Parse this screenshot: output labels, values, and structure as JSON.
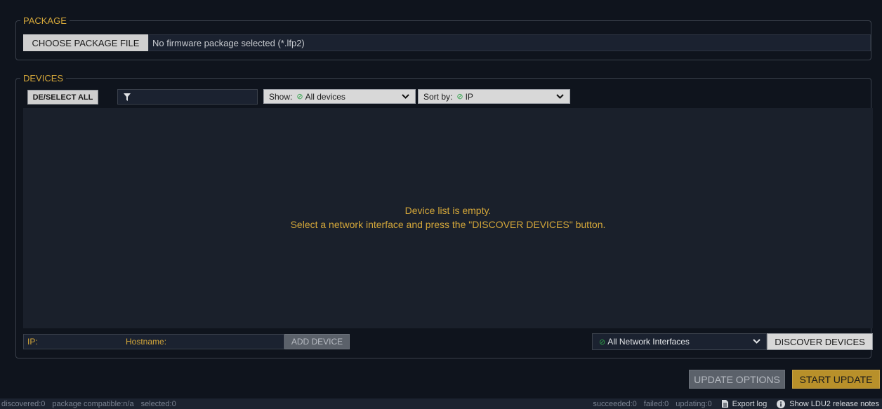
{
  "package": {
    "legend": "PACKAGE",
    "choose_label": "CHOOSE PACKAGE FILE",
    "file_text": "No firmware package selected (*.lfp2)"
  },
  "devices": {
    "legend": "DEVICES",
    "deselect_label": "DE/SELECT ALL",
    "filter_icon": "filter-icon",
    "show": {
      "label": "Show:",
      "value": "All devices"
    },
    "sort": {
      "label": "Sort by:",
      "value": "IP"
    },
    "empty_line1": "Device list is empty.",
    "empty_line2": "Select a network interface and press the \"DISCOVER DEVICES\" button.",
    "ip_label": "IP:",
    "hostname_label": "Hostname:",
    "add_device_label": "ADD DEVICE",
    "network_select": "All Network Interfaces",
    "discover_label": "DISCOVER DEVICES"
  },
  "actions": {
    "update_options_label": "UPDATE OPTIONS",
    "start_update_label": "START UPDATE"
  },
  "status": {
    "discovered": "discovered:0",
    "compatible": "package compatible:n/a",
    "selected": "selected:0",
    "succeeded": "succeeded:0",
    "failed": "failed:0",
    "updating": "updating:0",
    "export_log": "Export log",
    "release_notes": "Show LDU2 release notes"
  },
  "colors": {
    "accent": "#d4a73a",
    "background": "#0f141d",
    "ok_green": "#2fa34a"
  }
}
